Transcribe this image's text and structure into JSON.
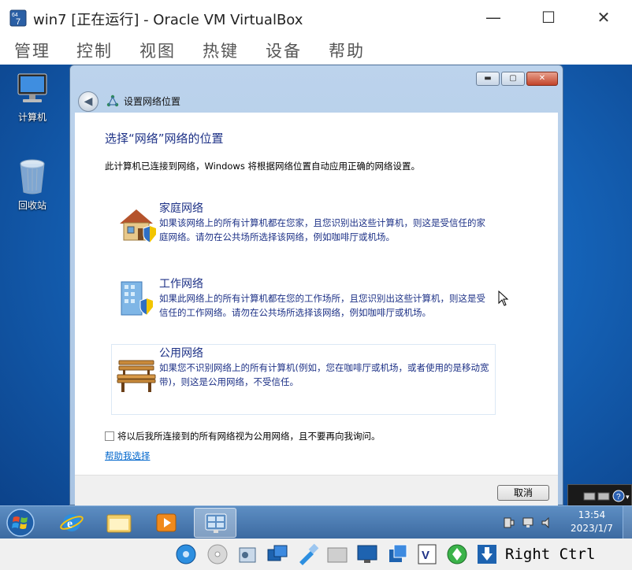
{
  "host": {
    "title": "win7 [正在运行] - Oracle VM VirtualBox",
    "menu": [
      "管理",
      "控制",
      "视图",
      "热键",
      "设备",
      "帮助"
    ],
    "window_buttons": {
      "minimize": "—",
      "maximize": "☐",
      "close": "✕"
    },
    "host_key_label": "Right Ctrl"
  },
  "desktop": {
    "icons": [
      {
        "label": "计算机",
        "icon": "computer-icon"
      },
      {
        "label": "回收站",
        "icon": "recycle-bin-icon"
      }
    ]
  },
  "dialog": {
    "nav_title": "设置网络位置",
    "heading": "选择“网络”网络的位置",
    "description": "此计算机已连接到网络，Windows 将根据网络位置自动应用正确的网络设置。",
    "options": [
      {
        "title": "家庭网络",
        "desc": "如果该网络上的所有计算机都在您家，且您识别出这些计算机，则这是受信任的家庭网络。请勿在公共场所选择该网络，例如咖啡厅或机场。",
        "icon": "home-network-icon"
      },
      {
        "title": "工作网络",
        "desc": "如果此网络上的所有计算机都在您的工作场所，且您识别出这些计算机，则这是受信任的工作网络。请勿在公共场所选择该网络，例如咖啡厅或机场。",
        "icon": "work-network-icon"
      },
      {
        "title": "公用网络",
        "desc": "如果您不识别网络上的所有计算机(例如，您在咖啡厅或机场，或者使用的是移动宽带)，则这是公用网络，不受信任。",
        "icon": "public-network-icon"
      }
    ],
    "checkbox_label": "将以后我所连接到的所有网络视为公用网络，且不要再向我询问。",
    "checkbox_checked": false,
    "help_link": "帮助我选择",
    "cancel_label": "取消"
  },
  "taskbar": {
    "time": "13:54",
    "date": "2023/1/7",
    "pinned": [
      "internet-explorer-icon",
      "file-explorer-icon",
      "media-player-icon",
      "network-settings-icon"
    ]
  },
  "colors": {
    "accent_text": "#1e3287",
    "link": "#0066cc",
    "taskbar": "#4a7bb4"
  }
}
